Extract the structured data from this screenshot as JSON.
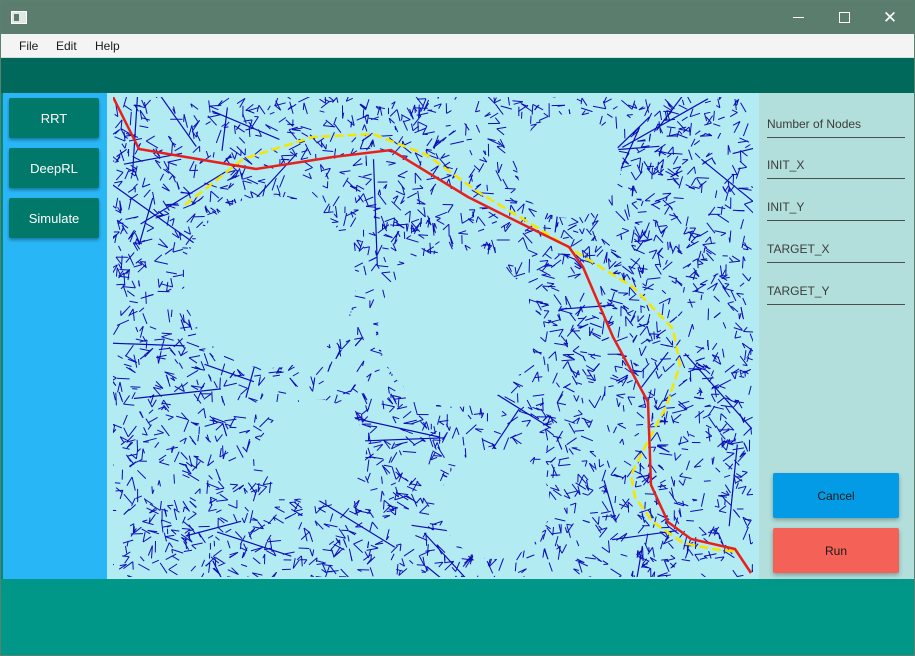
{
  "window": {
    "icon": "window-app-icon"
  },
  "menu": {
    "file": "File",
    "edit": "Edit",
    "help": "Help"
  },
  "sidebar": {
    "rrt": "RRT",
    "deeprl": "DeepRL",
    "simulate": "Simulate"
  },
  "fields": {
    "num_nodes": "Number of Nodes",
    "init_x": "INIT_X",
    "init_y": "INIT_Y",
    "target_x": "TARGET_X",
    "target_y": "TARGET_Y"
  },
  "actions": {
    "cancel": "Cancel",
    "run": "Run"
  },
  "colors": {
    "tree": "#0d0db8",
    "path_red": "#e8201c",
    "path_yellow": "#f5e600",
    "obstacle": "#b2ebf2",
    "cancel_bg": "#039be5",
    "run_bg": "#f46157"
  },
  "icons": [
    "minimize-icon",
    "maximize-icon",
    "close-icon"
  ]
}
